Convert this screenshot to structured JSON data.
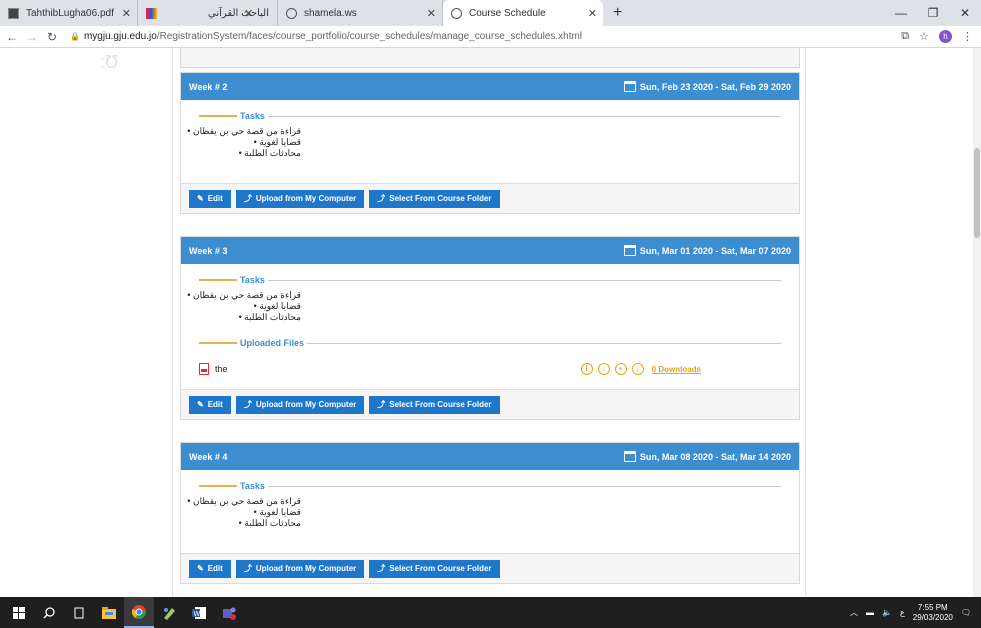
{
  "tabs": [
    {
      "title": "TahthibLugha06.pdf",
      "active": false
    },
    {
      "title": "الباحث القرآني",
      "active": false
    },
    {
      "title": "shamela.ws",
      "active": false
    },
    {
      "title": "Course Schedule",
      "active": true
    }
  ],
  "address": {
    "host": "mygju.gju.edu.jo",
    "path": "/RegistrationSystem/faces/course_portfolio/course_schedules/manage_course_schedules.xhtml"
  },
  "profile_initial": "h",
  "weeks": [
    {
      "title": "Week # 2",
      "date_range": "Sun, Feb 23 2020 - Sat, Feb 29 2020",
      "tasks_label": "Tasks",
      "tasks": [
        "قراءة من قصة حي بن يقظان",
        "قضايا لغوية",
        "محادثات الطلبة"
      ]
    },
    {
      "title": "Week # 3",
      "date_range": "Sun, Mar 01 2020 - Sat, Mar 07 2020",
      "tasks_label": "Tasks",
      "tasks": [
        "قراءة من قصة حي بن يقظان",
        "قضايا لغوية",
        "محادثات الطلبة"
      ],
      "files_label": "Uploaded Files",
      "file_name": "the",
      "downloads": "0 Downloads"
    },
    {
      "title": "Week # 4",
      "date_range": "Sun, Mar 08 2020 - Sat, Mar 14 2020",
      "tasks_label": "Tasks",
      "tasks": [
        "قراءة من قصة حي بن يقظان",
        "قضايا لغوية",
        "محادثات الطلبة"
      ]
    }
  ],
  "buttons": {
    "edit": "Edit",
    "upload": "Upload from My Computer",
    "select": "Select From Course Folder"
  },
  "clock": {
    "time": "7:55 PM",
    "date": "29/03/2020",
    "lang": "ع"
  },
  "colors": {
    "header_blue": "#3d8ed0",
    "button_blue": "#1f77c9",
    "accent_orange": "#e8a317"
  }
}
